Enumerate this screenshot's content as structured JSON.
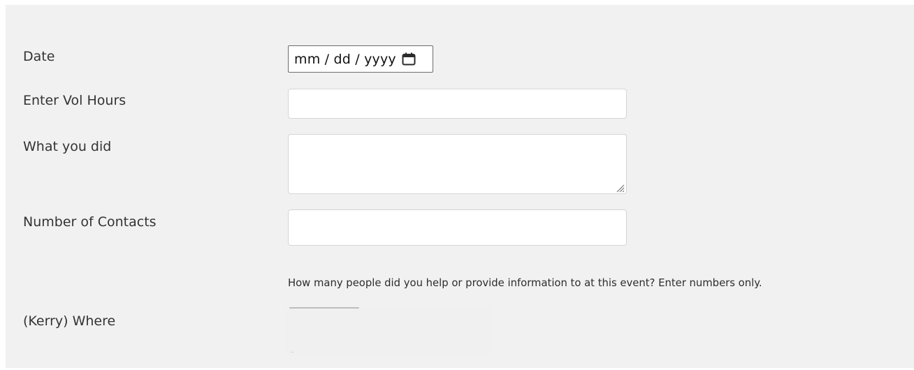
{
  "form": {
    "date_label": "Date",
    "date_placeholder": "mm / dd / yyyy",
    "hours_label": "Enter Vol Hours",
    "hours_value": "",
    "did_label": "What you did",
    "did_value": "",
    "contacts_label": "Number of Contacts",
    "contacts_value": "",
    "contacts_help": "How many people did you help or provide information to at this event? Enter numbers only.",
    "where_label": "(Kerry) Where"
  },
  "icons": {
    "date_picker": "calendar-icon",
    "textarea_resize": "resize-grip-icon"
  },
  "colors": {
    "panel_background": "#f1f1f1",
    "field_background": "#ffffff",
    "field_border": "#d5d5d5",
    "text": "#333333"
  }
}
